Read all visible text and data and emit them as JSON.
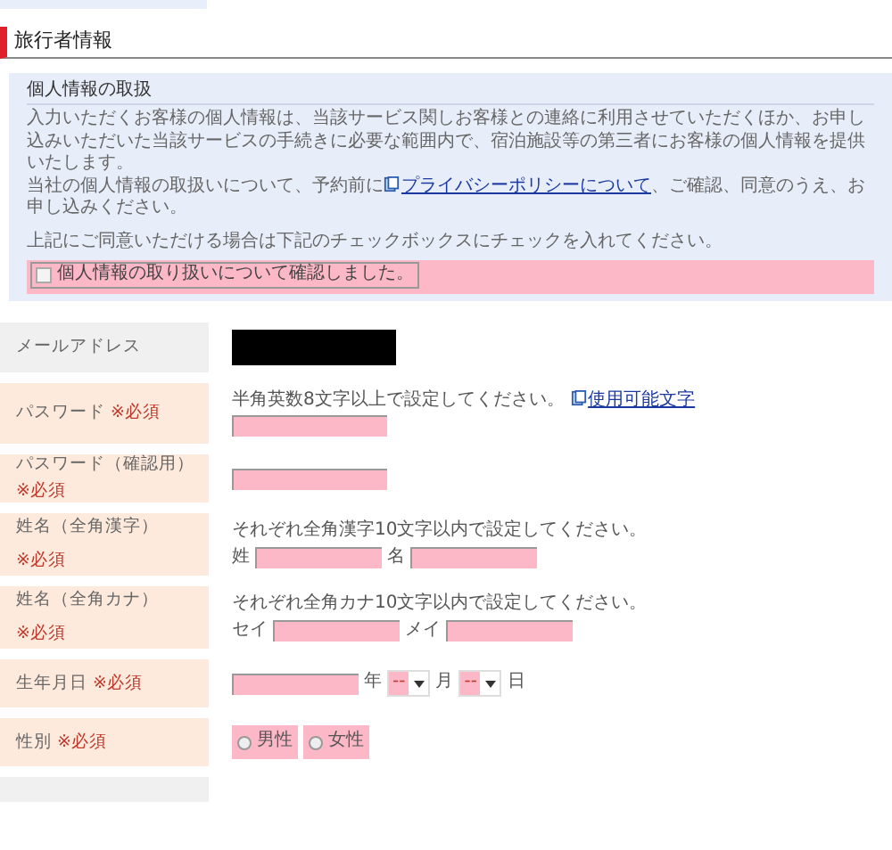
{
  "heading": "旅行者情報",
  "privacy": {
    "title": "個人情報の取扱",
    "paragraph": "入力いただくお客様の個人情報は、当該サービス関しお客様との連絡に利用させていただくほか、お申し込みいただいた当該サービスの手続きに必要な範囲内で、宿泊施設等の第三者にお客様の個人情報を提供いたします。",
    "policy_before": "当社の個人情報の取扱いについて、予約前に",
    "policy_link": "プライバシーポリシーについて",
    "policy_after": "、ご確認、同意のうえ、お申し込みください。",
    "instruction": "上記にご同意いただける場合は下記のチェックボックスにチェックを入れてください。",
    "consent": {
      "label": "個人情報の取り扱いについて確認しました。",
      "checked": false
    }
  },
  "rows": [
    {
      "kind": "redacted",
      "label": "メールアドレス"
    },
    {
      "kind": "text",
      "label": "パスワード",
      "required_mark": "※必須",
      "hint": "半角英数8文字以上で設定してください。",
      "hint_link": "使用可能文字"
    },
    {
      "kind": "text",
      "label": "パスワード（確認用）",
      "required_mark": "※必須"
    },
    {
      "kind": "pair",
      "label": "姓名（全角漢字）",
      "required_mark": "※必須",
      "hint": "それぞれ全角漢字10文字以内で設定してください。",
      "first": "姓",
      "second": "名"
    },
    {
      "kind": "pair",
      "label": "姓名（全角カナ）",
      "required_mark": "※必須",
      "hint": "それぞれ全角カナ10文字以内で設定してください。",
      "first": "セイ",
      "second": "メイ"
    },
    {
      "kind": "date",
      "label": "生年月日",
      "required_mark": "※必須",
      "year": "年",
      "month": "--",
      "month_unit": "月",
      "day": "--",
      "day_unit": "日"
    },
    {
      "kind": "radio",
      "label": "性別",
      "required_mark": "※必須",
      "options": [
        {
          "label": "男性",
          "selected": false
        },
        {
          "label": "女性",
          "selected": false
        }
      ]
    },
    {
      "kind": "cut"
    }
  ]
}
